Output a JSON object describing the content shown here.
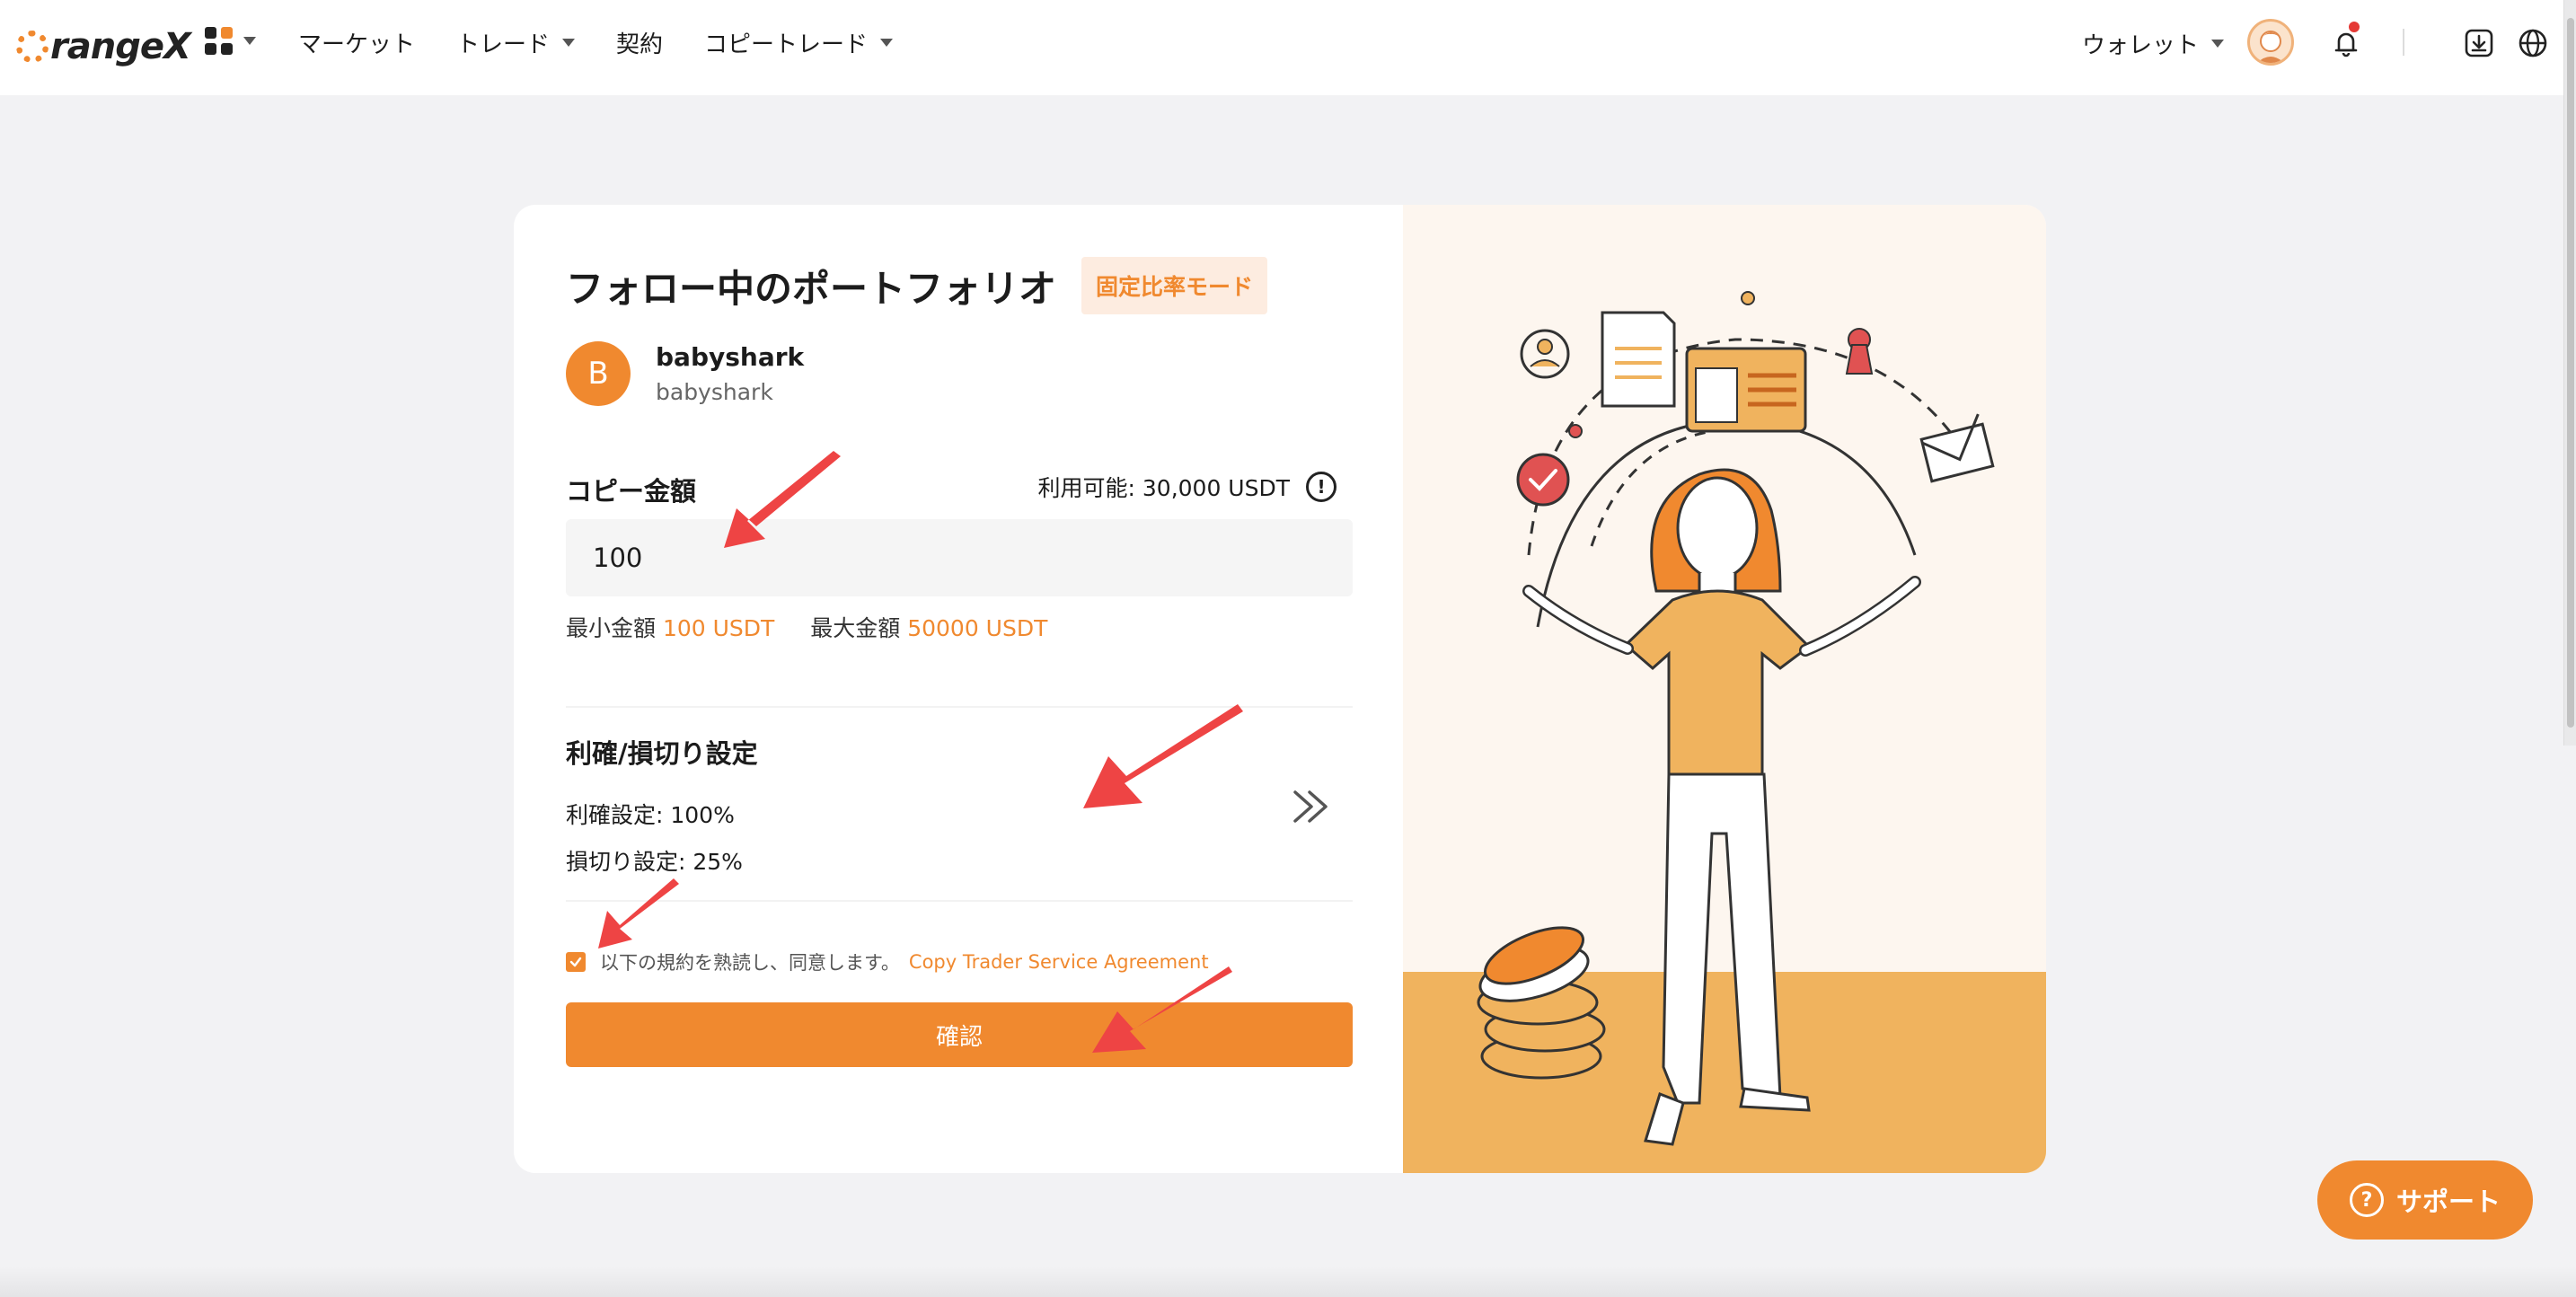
{
  "header": {
    "logo_text": "rangeX",
    "nav": [
      {
        "label": "マーケット",
        "dropdown": false
      },
      {
        "label": "トレード",
        "dropdown": true
      },
      {
        "label": "契約",
        "dropdown": false
      },
      {
        "label": "コピートレード",
        "dropdown": true
      }
    ],
    "wallet_label": "ウォレット",
    "icons": [
      "apps-grid-icon",
      "bell-icon",
      "download-icon",
      "globe-icon"
    ]
  },
  "card": {
    "title": "フォロー中のポートフォリオ",
    "mode_badge": "固定比率モード",
    "trader": {
      "initial": "B",
      "name": "babyshark",
      "id": "babyshark"
    },
    "copy_amount": {
      "label": "コピー金額",
      "available": "利用可能: 30,000 USDT",
      "value": "100",
      "min_label": "最小金額",
      "min_value": "100 USDT",
      "max_label": "最大金額",
      "max_value": "50000 USDT"
    },
    "tp_sl": {
      "title": "利確/損切り設定",
      "take_profit": "利確設定: 100%",
      "stop_loss": "損切り設定: 25%"
    },
    "agreement": {
      "checked": true,
      "text": "以下の規約を熟読し、同意します。",
      "link": "Copy Trader Service Agreement"
    },
    "confirm_label": "確認"
  },
  "support_label": "サポート",
  "colors": {
    "accent": "#f0892f",
    "annotation": "#ee4444",
    "illustration_floor": "#f0b35e"
  }
}
